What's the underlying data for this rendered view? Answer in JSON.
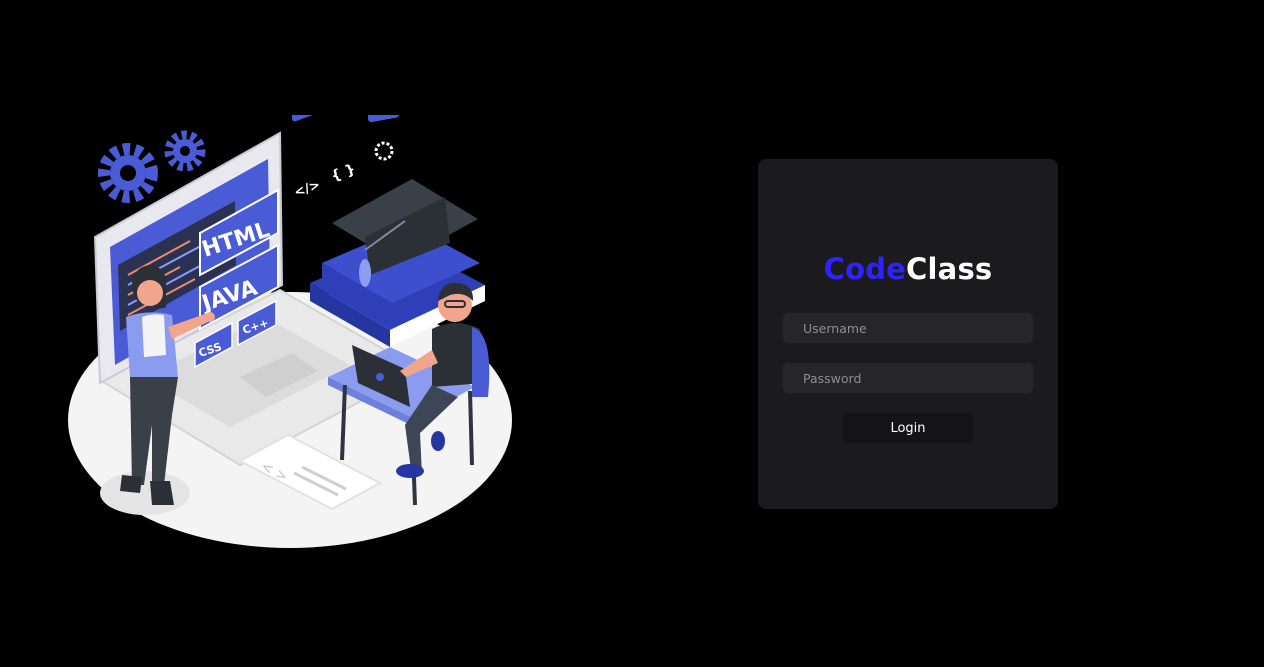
{
  "brand": {
    "part1": "Code",
    "part2": "Class"
  },
  "login_form": {
    "username_placeholder": "Username",
    "password_placeholder": "Password",
    "login_label": "Login"
  },
  "illustration": {
    "labels": {
      "html": "HTML",
      "java": "JAVA",
      "css": "CSS",
      "cpp": "C++",
      "code_tag": "</>",
      "braces": "{ }"
    }
  },
  "colors": {
    "background": "#000000",
    "card": "#1b1b1d",
    "input": "#262628",
    "button": "#141416",
    "brand_blue": "#2f22ff",
    "illustration_blue": "#4a5bd6"
  }
}
